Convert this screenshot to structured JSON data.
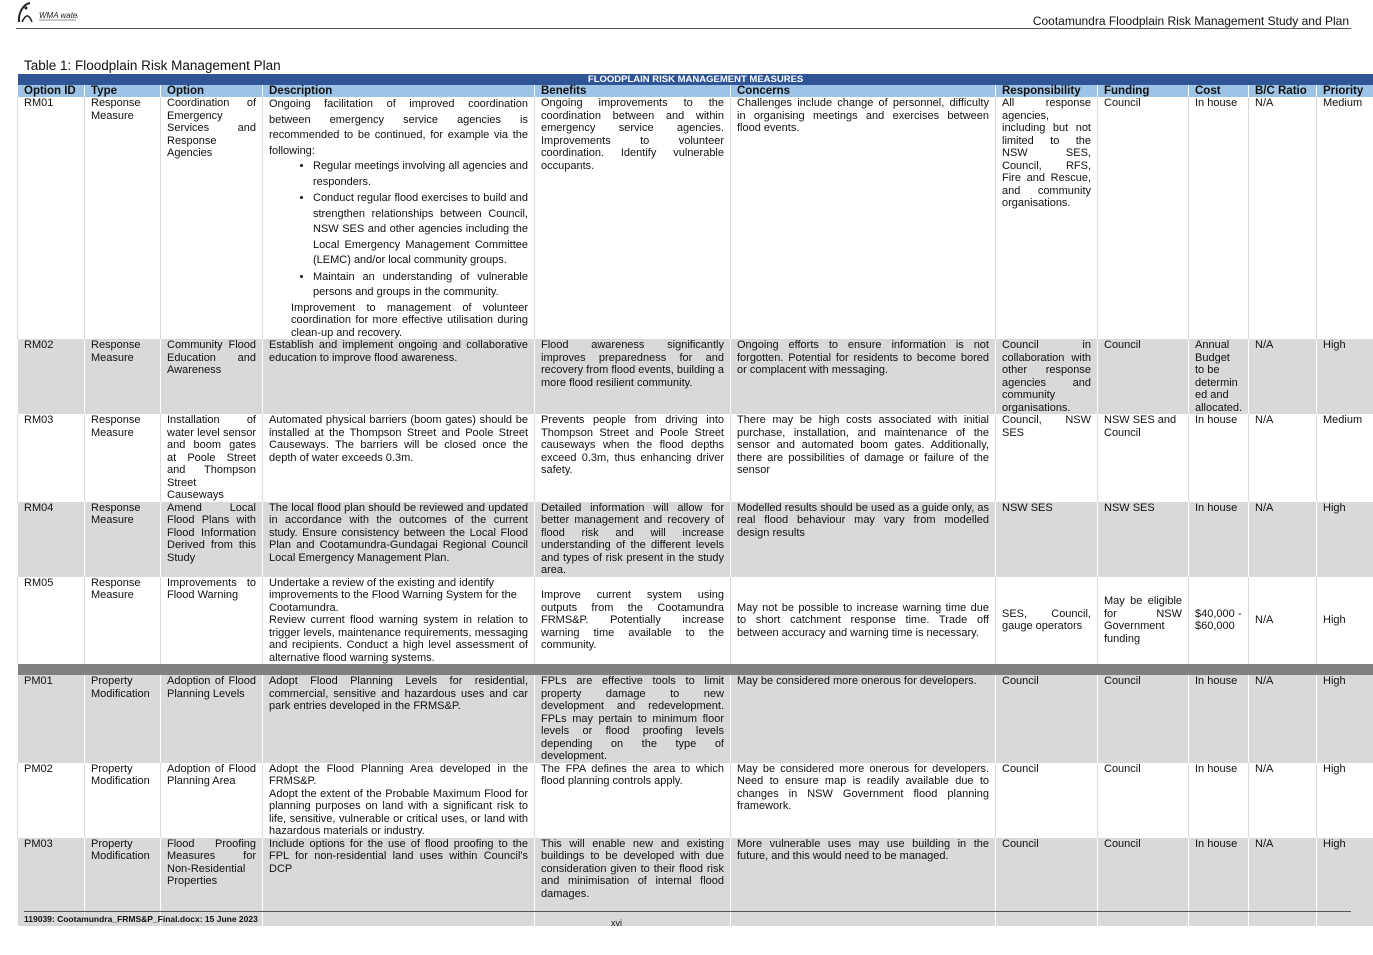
{
  "header": {
    "logo_text": "WMA water",
    "doc_title": "Cootamundra Floodplain Risk Management Study and Plan"
  },
  "caption": "Table 1: Floodplain Risk Management Plan",
  "band": "FLOODPLAIN RISK MANAGEMENT MEASURES",
  "columns": [
    "Option ID",
    "Type",
    "Option",
    "Description",
    "Benefits",
    "Concerns",
    "Responsibility",
    "Funding",
    "Cost",
    "B/C Ratio",
    "Priority"
  ],
  "rows": [
    {
      "id": "RM01",
      "type": "Response Measure",
      "option": "Coordination of Emergency Services and Response Agencies",
      "desc_intro": "Ongoing facilitation of improved coordination between emergency service agencies is recommended to be continued, for example via the following:",
      "desc_bullets": [
        "Regular meetings involving all agencies and responders.",
        "Conduct regular flood exercises to build and strengthen relationships between Council, NSW SES and other agencies including the Local Emergency Management Committee (LEMC) and/or local community groups.",
        "Maintain an understanding of vulnerable persons and groups in the community."
      ],
      "desc_outro": "Improvement to management of volunteer coordination for more effective utilisation during clean-up and recovery.",
      "benefits": "Ongoing improvements to the coordination between and within emergency service agencies. Improvements to volunteer coordination. Identify vulnerable occupants.",
      "concerns": "Challenges include change of personnel, difficulty in organising meetings and exercises between flood events.",
      "responsibility": "All response agencies, including but not limited to the NSW SES, Council, RFS, Fire and Rescue, and community organisations.",
      "funding": "Council",
      "cost": "In house",
      "bc": "N/A",
      "priority": "Medium"
    },
    {
      "id": "RM02",
      "type": "Response Measure",
      "option": "Community Flood Education and Awareness",
      "description": "Establish and implement ongoing and collaborative education to improve flood awareness.",
      "benefits": "Flood awareness significantly improves preparedness for and recovery from flood events, building a more flood resilient community.",
      "concerns": "Ongoing efforts to ensure information is not forgotten. Potential for residents to become bored or complacent with messaging.",
      "responsibility": "Council in collaboration with other response agencies and community organisations.",
      "funding": "Council",
      "cost": "Annual Budget to be determin ed and allocated.",
      "bc": "N/A",
      "priority": "High"
    },
    {
      "id": "RM03",
      "type": "Response Measure",
      "option": "Installation of water level sensor and boom gates at Poole Street and Thompson Street Causeways",
      "description": "Automated physical barriers (boom gates) should be installed at the Thompson Street and Poole Street Causeways. The barriers will be closed once the depth of water exceeds 0.3m.",
      "benefits": "Prevents people from driving into Thompson Street and Poole Street causeways when the flood depths exceed 0.3m, thus enhancing driver safety.",
      "concerns": "There may be high costs associated with initial purchase, installation, and maintenance of the sensor and automated boom gates. Additionally, there are possibilities of damage or failure of the sensor",
      "responsibility": "Council, NSW SES",
      "funding": "NSW SES and Council",
      "cost": "In house",
      "bc": "N/A",
      "priority": "Medium"
    },
    {
      "id": "RM04",
      "type": "Response Measure",
      "option": "Amend Local Flood Plans with Flood Information Derived from this Study",
      "description": "The local flood plan should be reviewed and updated in accordance with the outcomes of the current study. Ensure consistency between the Local Flood Plan and Cootamundra-Gundagai Regional Council Local Emergency Management Plan.",
      "benefits": "Detailed information will allow for better management and recovery of flood risk and will increase understanding of the different levels and types of risk present in the study area.",
      "concerns": "Modelled results should be used as a guide only, as real flood behaviour may vary from modelled design results",
      "responsibility": "NSW SES",
      "funding": "NSW SES",
      "cost": "In house",
      "bc": "N/A",
      "priority": "High"
    },
    {
      "id": "RM05",
      "type": "Response Measure",
      "option": "Improvements to Flood Warning",
      "desc_p1": "Undertake a review of the existing and identify improvements to the Flood Warning System for the Cootamundra.",
      "desc_p2": "Review current flood warning system in relation to trigger levels, maintenance requirements, messaging and recipients. Conduct a high level assessment of alternative flood warning systems.",
      "benefits": "Improve current system using outputs from the Cootamundra FRMS&P. Potentially increase warning time available to the community.",
      "concerns": "May not be possible to increase warning time due to short catchment response time. Trade off between accuracy and warning time is necessary.",
      "responsibility": "SES, Council, gauge operators",
      "funding": "May be eligible for NSW Government funding",
      "cost": "$40,000 - $60,000",
      "bc": "N/A",
      "priority": "High"
    },
    {
      "id": "PM01",
      "type": "Property Modification",
      "option": "Adoption of Flood Planning Levels",
      "description": "Adopt Flood Planning Levels for residential, commercial, sensitive and hazardous uses and car park entries developed in the FRMS&P.",
      "benefits": "FPLs are effective tools to limit property damage to new development and redevelopment. FPLs may pertain to minimum floor levels or flood proofing levels depending on the type of development.",
      "concerns": "May be considered more onerous for developers.",
      "responsibility": "Council",
      "funding": "Council",
      "cost": "In house",
      "bc": "N/A",
      "priority": "High"
    },
    {
      "id": "PM02",
      "type": "Property Modification",
      "option": "Adoption of Flood Planning Area",
      "desc_p1": "Adopt the Flood Planning Area developed in the FRMS&P.",
      "desc_p2": "Adopt the extent of the Probable Maximum Flood for planning purposes on land with a significant risk to life, sensitive, vulnerable or critical uses, or land with hazardous materials or industry.",
      "benefits": "The FPA defines the area to which flood planning controls apply.",
      "concerns": "May be considered more onerous for developers. Need to ensure map is readily available due to changes in NSW Government flood planning framework.",
      "responsibility": "Council",
      "funding": "Council",
      "cost": "In house",
      "bc": "N/A",
      "priority": "High"
    },
    {
      "id": "PM03",
      "type": "Property Modification",
      "option": "Flood Proofing Measures for Non-Residential Properties",
      "description": "Include options for the use of flood proofing to the FPL for non-residential land uses within Council's DCP",
      "benefits": "This will enable new and existing buildings to be developed with due consideration given to their flood risk and minimisation of internal flood damages.",
      "concerns": "More vulnerable uses may use building in the future, and this would need to be managed.",
      "responsibility": "Council",
      "funding": "Council",
      "cost": "In house",
      "bc": "N/A",
      "priority": "High"
    }
  ],
  "footer": {
    "file": "119039: Cootamundra_FRMS&P_Final.docx: 15 June 2023",
    "page": "xvi"
  }
}
